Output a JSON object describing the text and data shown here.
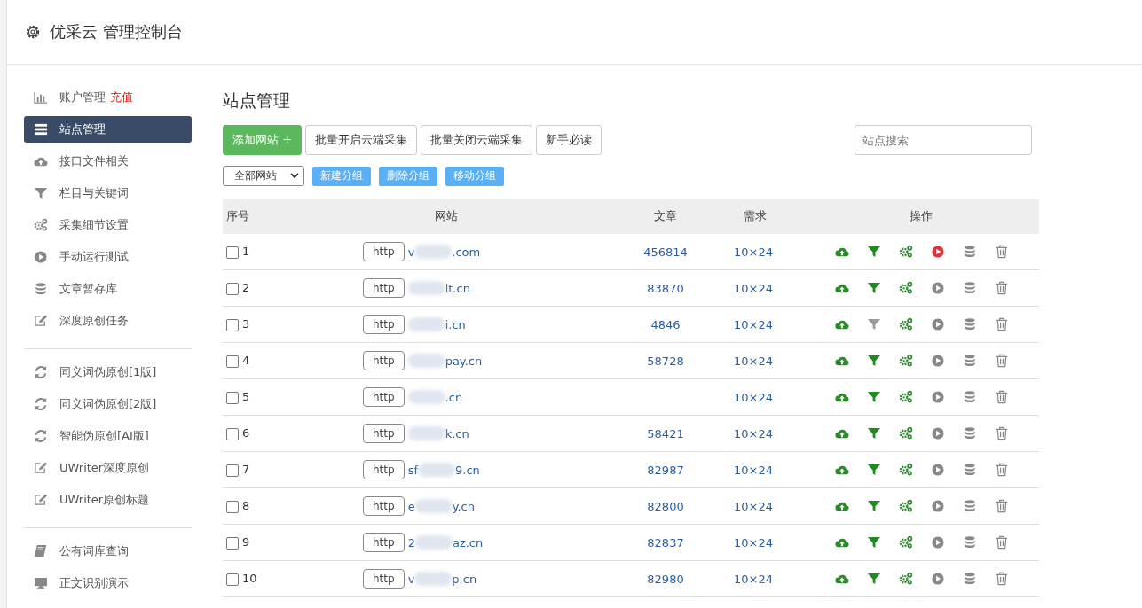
{
  "header": {
    "title": "优采云 管理控制台"
  },
  "sidebar": {
    "groups": [
      [
        {
          "kind": "chart",
          "label": "账户管理",
          "badge": "充值",
          "selected": false
        },
        {
          "kind": "list",
          "label": "站点管理",
          "selected": true
        },
        {
          "kind": "cloud",
          "label": "接口文件相关",
          "selected": false
        },
        {
          "kind": "filter",
          "label": "栏目与关键词",
          "selected": false
        },
        {
          "kind": "gears",
          "label": "采集细节设置",
          "selected": false
        },
        {
          "kind": "play",
          "label": "手动运行测试",
          "selected": false
        },
        {
          "kind": "db",
          "label": "文章暂存库",
          "selected": false
        },
        {
          "kind": "edit",
          "label": "深度原创任务",
          "selected": false
        }
      ],
      [
        {
          "kind": "refresh",
          "label": "同义词伪原创[1版]",
          "selected": false
        },
        {
          "kind": "refresh",
          "label": "同义词伪原创[2版]",
          "selected": false
        },
        {
          "kind": "refresh",
          "label": "智能伪原创[AI版]",
          "selected": false
        },
        {
          "kind": "edit",
          "label": "UWriter深度原创",
          "selected": false
        },
        {
          "kind": "edit",
          "label": "UWriter原创标题",
          "selected": false
        }
      ],
      [
        {
          "kind": "book",
          "label": "公有词库查询",
          "selected": false
        },
        {
          "kind": "monitor",
          "label": "正文识别演示",
          "selected": false
        }
      ]
    ]
  },
  "main": {
    "title": "站点管理",
    "toolbar": [
      {
        "label": "添加网站 +",
        "kind": "primary"
      },
      {
        "label": "批量开启云端采集",
        "kind": "default"
      },
      {
        "label": "批量关闭云端采集",
        "kind": "default"
      },
      {
        "label": "新手必读",
        "kind": "default"
      }
    ],
    "search": {
      "placeholder": "站点搜索"
    },
    "filter_select": {
      "value": "全部网站"
    },
    "group_buttons": [
      "新建分组",
      "删除分组",
      "移动分组"
    ],
    "table": {
      "columns": [
        "序号",
        "网站",
        "文章",
        "需求",
        "操作"
      ],
      "rows": [
        {
          "checked": false,
          "index": "1",
          "protocol": "http",
          "site_start": "v",
          "site_end": ".com",
          "articles": "456814",
          "demand": "10×24",
          "filter_on": true,
          "running": true
        },
        {
          "checked": false,
          "index": "2",
          "protocol": "http",
          "site_start": "",
          "site_end": "lt.cn",
          "articles": "83870",
          "demand": "10×24",
          "filter_on": true,
          "running": false
        },
        {
          "checked": false,
          "index": "3",
          "protocol": "http",
          "site_start": "",
          "site_end": "i.cn",
          "articles": "4846",
          "demand": "10×24",
          "filter_on": false,
          "running": false
        },
        {
          "checked": false,
          "index": "4",
          "protocol": "http",
          "site_start": "",
          "site_end": "pay.cn",
          "articles": "58728",
          "demand": "10×24",
          "filter_on": true,
          "running": false
        },
        {
          "checked": false,
          "index": "5",
          "protocol": "http",
          "site_start": "",
          "site_end": ".cn",
          "demand": "10×24",
          "filter_on": true,
          "running": false
        },
        {
          "checked": false,
          "index": "6",
          "protocol": "http",
          "site_start": "",
          "site_end": "k.cn",
          "articles": "58421",
          "demand": "10×24",
          "filter_on": true,
          "running": false
        },
        {
          "checked": false,
          "index": "7",
          "protocol": "http",
          "site_start": "sf",
          "site_end": "9.cn",
          "articles": "82987",
          "demand": "10×24",
          "filter_on": true,
          "running": false
        },
        {
          "checked": false,
          "index": "8",
          "protocol": "http",
          "site_start": "e",
          "site_end": "y.cn",
          "articles": "82800",
          "demand": "10×24",
          "filter_on": true,
          "running": false
        },
        {
          "checked": false,
          "index": "9",
          "protocol": "http",
          "site_start": "2",
          "site_end": "az.cn",
          "articles": "82837",
          "demand": "10×24",
          "filter_on": true,
          "running": false
        },
        {
          "checked": false,
          "index": "10",
          "protocol": "http",
          "site_start": "v",
          "site_end": "p.cn",
          "articles": "82980",
          "demand": "10×24",
          "filter_on": true,
          "running": false
        }
      ]
    }
  }
}
